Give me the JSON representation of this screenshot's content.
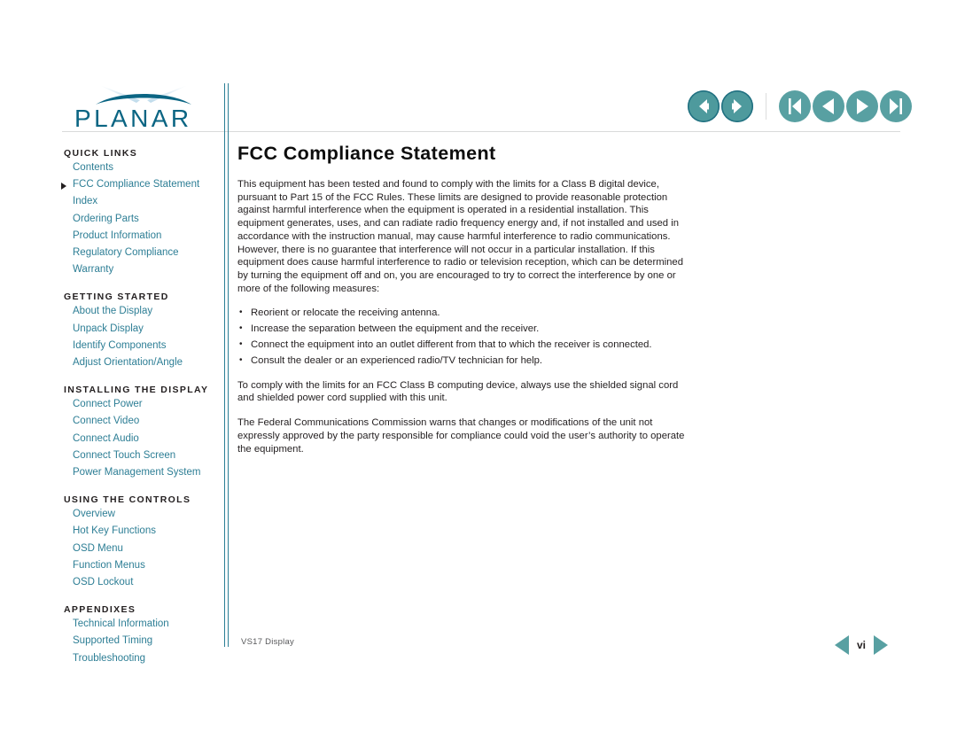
{
  "brand": {
    "name": "PLANAR",
    "logo_color": "#0b6583",
    "swoosh_color": "#0b6583"
  },
  "theme": {
    "link_color": "#2d7e95",
    "accent_teal": "#58a0a2",
    "rule_color": "#2b7f96",
    "text_color": "#231f20"
  },
  "topnav": {
    "group_back_forward": [
      {
        "label": "Back",
        "icon": "arrow-left-circle-icon"
      },
      {
        "label": "Forward",
        "icon": "arrow-right-circle-icon"
      }
    ],
    "group_paging": [
      {
        "label": "First Page",
        "icon": "skip-back-circle-icon"
      },
      {
        "label": "Previous Page",
        "icon": "play-back-circle-icon"
      },
      {
        "label": "Next Page",
        "icon": "play-forward-circle-icon"
      },
      {
        "label": "Last Page",
        "icon": "skip-forward-circle-icon"
      }
    ]
  },
  "sidebar": {
    "sections": [
      {
        "heading": "QUICK LINKS",
        "links": [
          {
            "label": "Contents",
            "current": false
          },
          {
            "label": "FCC Compliance Statement",
            "current": true
          },
          {
            "label": "Index",
            "current": false
          },
          {
            "label": "Ordering Parts",
            "current": false
          },
          {
            "label": "Product Information",
            "current": false
          },
          {
            "label": "Regulatory Compliance",
            "current": false
          },
          {
            "label": "Warranty",
            "current": false
          }
        ]
      },
      {
        "heading": "GETTING STARTED",
        "links": [
          {
            "label": "About the Display",
            "current": false
          },
          {
            "label": "Unpack Display",
            "current": false
          },
          {
            "label": "Identify Components",
            "current": false
          },
          {
            "label": "Adjust Orientation/Angle",
            "current": false
          }
        ]
      },
      {
        "heading": "INSTALLING THE DISPLAY",
        "links": [
          {
            "label": "Connect Power",
            "current": false
          },
          {
            "label": "Connect Video",
            "current": false
          },
          {
            "label": "Connect Audio",
            "current": false
          },
          {
            "label": "Connect Touch Screen",
            "current": false
          },
          {
            "label": "Power Management System",
            "current": false
          }
        ]
      },
      {
        "heading": "USING THE CONTROLS",
        "links": [
          {
            "label": "Overview",
            "current": false
          },
          {
            "label": "Hot Key Functions",
            "current": false
          },
          {
            "label": "OSD Menu",
            "current": false
          },
          {
            "label": "Function Menus",
            "current": false
          },
          {
            "label": "OSD Lockout",
            "current": false
          }
        ]
      },
      {
        "heading": "APPENDIXES",
        "links": [
          {
            "label": "Technical Information",
            "current": false
          },
          {
            "label": "Supported Timing",
            "current": false
          },
          {
            "label": "Troubleshooting",
            "current": false
          }
        ]
      }
    ]
  },
  "content": {
    "title": "FCC Compliance Statement",
    "paragraph_1": "This equipment has been tested and found to comply with the limits for a Class B digital device, pursuant to Part 15 of the FCC Rules. These limits are designed to provide reasonable protection against harmful interference when the equipment is operated in a residential installation. This equipment generates, uses, and can radiate radio frequency energy and, if not installed and used in accordance with the instruction manual, may cause harmful interference to radio communications. However, there is no guarantee that interference will not occur in a particular installation. If this equipment does cause harmful interference to radio or television reception, which can be determined by turning the equipment off and on, you are encouraged to try to correct the interference by one or more of the following measures:",
    "bullets": [
      "Reorient or relocate the receiving antenna.",
      "Increase the separation between the equipment and the receiver.",
      "Connect the equipment into an outlet different from that to which the receiver is connected.",
      "Consult the dealer or an experienced radio/TV technician for help."
    ],
    "paragraph_2": "To comply with the limits for an FCC Class B computing device, always use the shielded signal cord and shielded power cord supplied with this unit.",
    "paragraph_3": "The Federal Communications Commission warns that changes or modifications of the unit not expressly approved by the party responsible for compliance could void the user’s authority to operate the equipment."
  },
  "footer": {
    "doc_label": "VS17 Display",
    "page_number": "vi",
    "prev_label": "Previous page",
    "next_label": "Next page"
  }
}
